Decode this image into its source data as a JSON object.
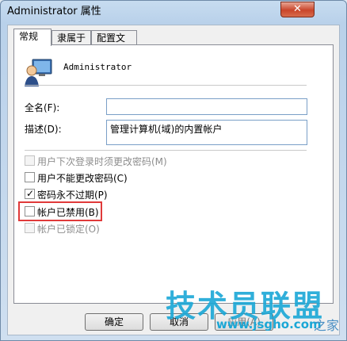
{
  "window": {
    "title": "Administrator 属性",
    "close_glyph": "✕"
  },
  "tabs": [
    {
      "label": "常规",
      "active": true
    },
    {
      "label": "隶属于",
      "active": false
    },
    {
      "label": "配置文件",
      "active": false
    }
  ],
  "user": {
    "name": "Administrator",
    "icon": "user-computer-icon"
  },
  "fields": {
    "fullname_label": "全名(F):",
    "fullname_value": "",
    "desc_label": "描述(D):",
    "desc_value": "管理计算机(域)的内置帐户"
  },
  "checkboxes": [
    {
      "label": "用户下次登录时须更改密码(M)",
      "checked": false,
      "disabled": true
    },
    {
      "label": "用户不能更改密码(C)",
      "checked": false,
      "disabled": false
    },
    {
      "label": "密码永不过期(P)",
      "checked": true,
      "disabled": false
    },
    {
      "label": "帐户已禁用(B)",
      "checked": false,
      "disabled": false
    },
    {
      "label": "帐户已锁定(O)",
      "checked": false,
      "disabled": true
    }
  ],
  "buttons": {
    "ok": "确定",
    "cancel": "取消",
    "apply": "应用(A)"
  },
  "watermark": {
    "text": "技术员联盟",
    "url": "www.jsgho.com",
    "suffix": "之家"
  },
  "colors": {
    "highlight": "#e03a3a",
    "watermark": "#1aa7d6"
  }
}
